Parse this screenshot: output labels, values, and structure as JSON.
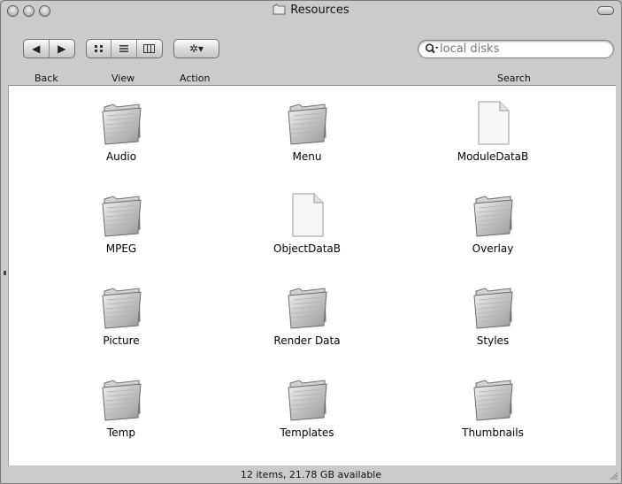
{
  "window": {
    "title": "Resources",
    "status": "12 items, 21.78 GB available"
  },
  "toolbar": {
    "back_label": "Back",
    "view_label": "View",
    "action_label": "Action",
    "search_label": "Search",
    "search_value": "local disks",
    "back_arrow": "◀",
    "forward_arrow": "▶",
    "view_icons": [
      "icon-view",
      "list-view",
      "column-view"
    ],
    "action_glyph": "✲▾",
    "search_glyph": "🔍︎"
  },
  "items": [
    {
      "name": "Audio",
      "kind": "folder"
    },
    {
      "name": "Menu",
      "kind": "folder"
    },
    {
      "name": "ModuleDataB",
      "kind": "document"
    },
    {
      "name": "MPEG",
      "kind": "folder"
    },
    {
      "name": "ObjectDataB",
      "kind": "document"
    },
    {
      "name": "Overlay",
      "kind": "folder"
    },
    {
      "name": "Picture",
      "kind": "folder"
    },
    {
      "name": "Render Data",
      "kind": "folder"
    },
    {
      "name": "Styles",
      "kind": "folder"
    },
    {
      "name": "Temp",
      "kind": "folder"
    },
    {
      "name": "Templates",
      "kind": "folder"
    },
    {
      "name": "Thumbnails",
      "kind": "folder"
    }
  ]
}
